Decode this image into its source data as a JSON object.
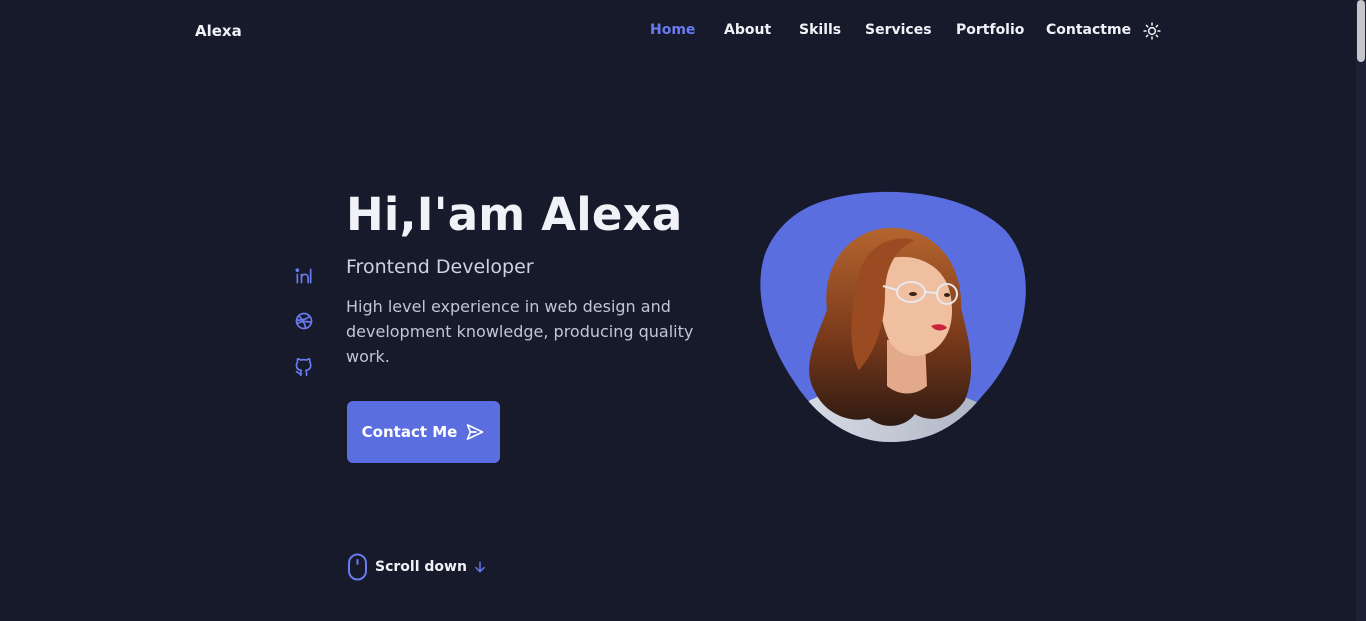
{
  "header": {
    "logo": "Alexa",
    "nav": [
      {
        "label": "Home",
        "active": true
      },
      {
        "label": "About",
        "active": false
      },
      {
        "label": "Skills",
        "active": false
      },
      {
        "label": "Services",
        "active": false
      },
      {
        "label": "Portfolio",
        "active": false
      },
      {
        "label": "Contactme",
        "active": false
      }
    ],
    "theme_icon": "sun-icon"
  },
  "social": [
    {
      "name": "linkedin-icon"
    },
    {
      "name": "dribbble-icon"
    },
    {
      "name": "github-icon"
    }
  ],
  "hero": {
    "title": "Hi,I'am Alexa",
    "subtitle": "Frontend Developer",
    "description": "High level experience in web design and development knowledge, producing quality work.",
    "button_label": "Contact Me",
    "button_icon": "send-icon"
  },
  "scroll": {
    "label": "Scroll down",
    "icon": "mouse-icon",
    "arrow_icon": "arrow-down-icon"
  },
  "colors": {
    "background": "#161a2b",
    "accent": "#5a6ee0",
    "accent_light": "#6a7bf0",
    "text": "#f1f2f7"
  }
}
